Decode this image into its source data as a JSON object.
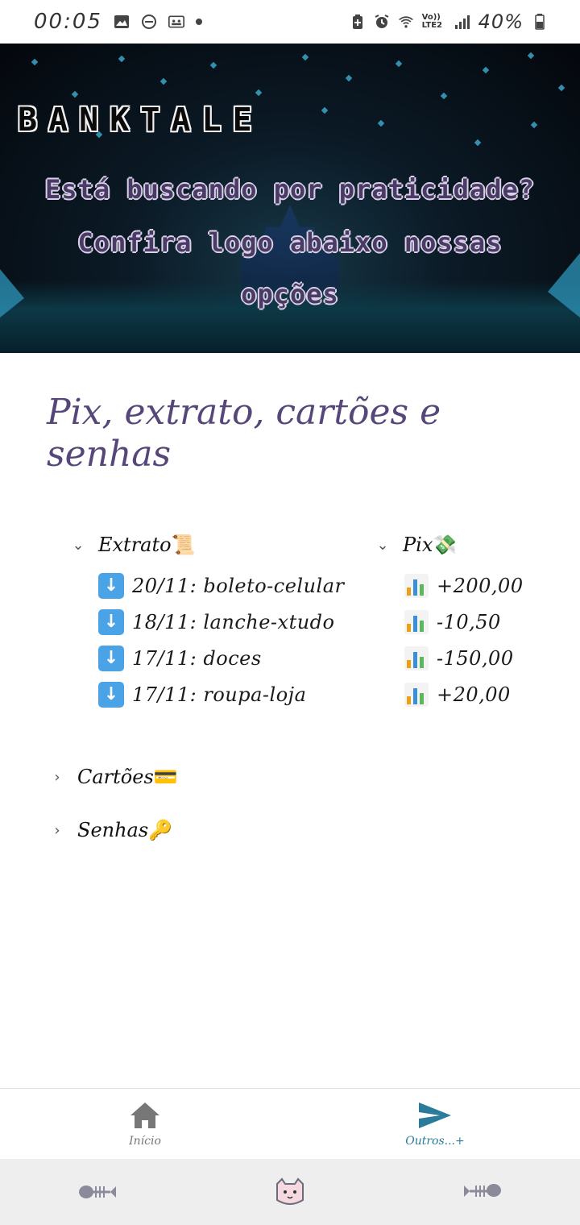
{
  "status_bar": {
    "time": "00:05",
    "battery": "40%",
    "network": "Vo)) LTE2"
  },
  "banner": {
    "title": "BANKTALE",
    "line1": "Está buscando por praticidade?",
    "line2": "Confira logo abaixo nossas",
    "line3": "opções"
  },
  "page": {
    "title": "Pix, extrato, cartões e senhas"
  },
  "sections": {
    "extrato": {
      "label": "Extrato",
      "emoji": "📜",
      "expanded": true,
      "rows": [
        {
          "icon": "down-arrow-icon",
          "text": "20/11: boleto-celular"
        },
        {
          "icon": "down-arrow-icon",
          "text": "18/11: lanche-xtudo"
        },
        {
          "icon": "down-arrow-icon",
          "text": "17/11: doces"
        },
        {
          "icon": "down-arrow-icon",
          "text": "17/11: roupa-loja"
        }
      ]
    },
    "pix": {
      "label": "Pix",
      "emoji": "💸",
      "expanded": true,
      "rows": [
        {
          "icon": "bar-chart-icon",
          "text": "+200,00"
        },
        {
          "icon": "bar-chart-icon",
          "text": "-10,50"
        },
        {
          "icon": "bar-chart-icon",
          "text": "-150,00"
        },
        {
          "icon": "bar-chart-icon",
          "text": "+20,00"
        }
      ]
    },
    "cartoes": {
      "label": "Cartões",
      "emoji": "💳",
      "expanded": false
    },
    "senhas": {
      "label": "Senhas",
      "emoji": "🔑",
      "expanded": false
    }
  },
  "bottom_nav": {
    "home": {
      "label": "Início",
      "icon": "home-icon",
      "active": false
    },
    "others": {
      "label": "Outros...+",
      "icon": "send-icon",
      "active": true
    }
  },
  "colors": {
    "heading": "#56467a",
    "accent": "#2a7c9a",
    "banner_text": "#4a3a66"
  }
}
